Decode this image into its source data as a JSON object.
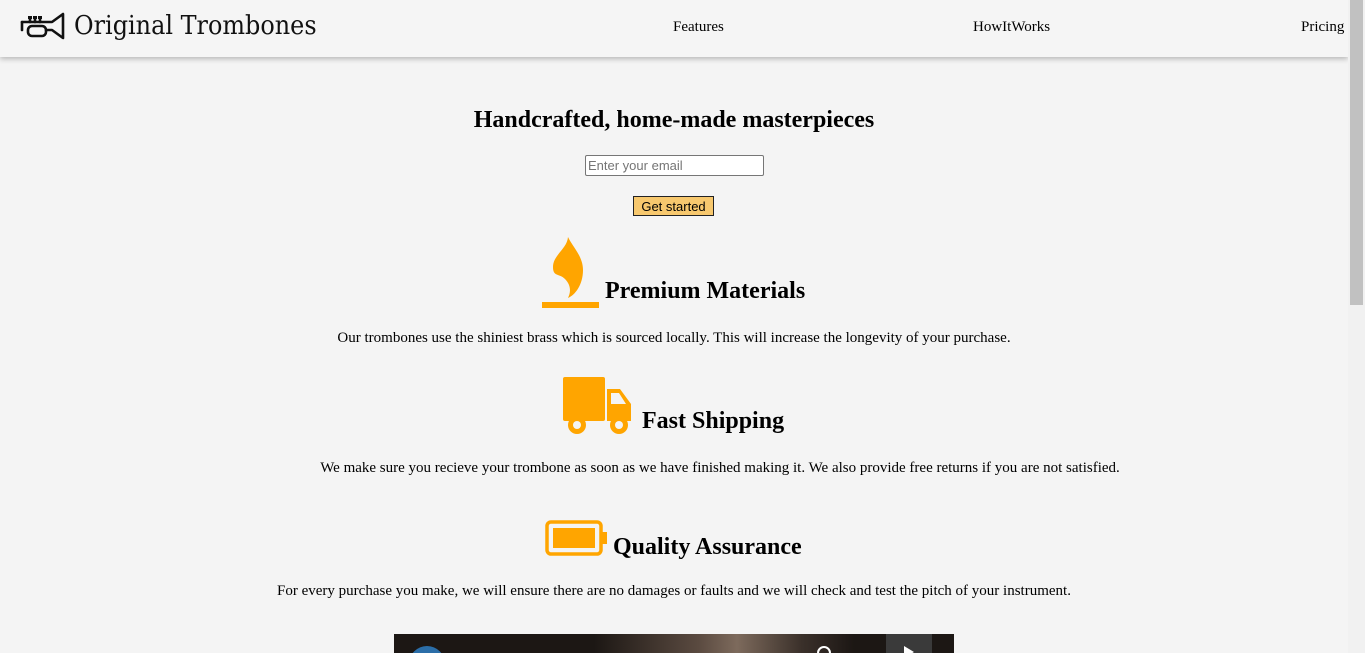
{
  "header": {
    "brand": "Original Trombones",
    "nav": {
      "features": "Features",
      "how_it_works": "HowItWorks",
      "pricing": "Pricing"
    }
  },
  "hero": {
    "title": "Handcrafted, home-made masterpieces",
    "email_placeholder": "Enter your email",
    "email_value": "",
    "button_label": "Get started"
  },
  "features": [
    {
      "icon": "fire-icon",
      "heading": "Premium Materials",
      "text": "Our trombones use the shiniest brass which is sourced locally. This will increase the longevity of your purchase."
    },
    {
      "icon": "truck-icon",
      "heading": "Fast Shipping",
      "text": "We make sure you recieve your trombone as soon as we have finished making it. We also provide free returns if you are not satisfied."
    },
    {
      "icon": "battery-full-icon",
      "heading": "Quality Assurance",
      "text": "For every purchase you make, we will ensure there are no damages or faults and we will check and test the pitch of your instrument."
    }
  ],
  "colors": {
    "accent": "#ffa500",
    "button": "#f7c86e",
    "background": "#f4f4f4"
  }
}
